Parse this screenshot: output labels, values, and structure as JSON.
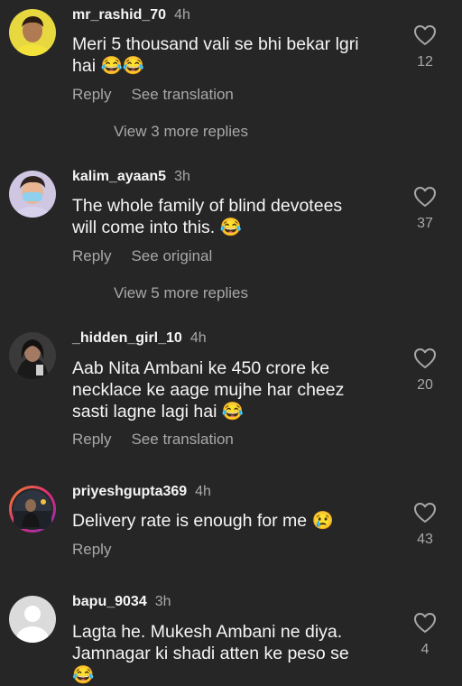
{
  "comments": [
    {
      "username": "mr_rashid_70",
      "time": "4h",
      "text": "Meri 5 thousand vali se bhi bekar lgri hai 😂😂",
      "likes": "12",
      "reply_label": "Reply",
      "second_action": "See translation",
      "view_more": "View 3 more replies"
    },
    {
      "username": "kalim_ayaan5",
      "time": "3h",
      "text": "The whole family of blind devotees will come into this. 😂",
      "likes": "37",
      "reply_label": "Reply",
      "second_action": "See original",
      "view_more": "View 5 more replies"
    },
    {
      "username": "_hidden_girl_10",
      "time": "4h",
      "text": "Aab Nita Ambani ke 450 crore ke necklace ke aage mujhe har cheez sasti lagne lagi hai 😂",
      "likes": "20",
      "reply_label": "Reply",
      "second_action": "See translation"
    },
    {
      "username": "priyeshgupta369",
      "time": "4h",
      "text": "Delivery rate is enough for me 😢",
      "likes": "43",
      "reply_label": "Reply"
    },
    {
      "username": "bapu_9034",
      "time": "3h",
      "text": "Lagta he.  Mukesh Ambani ne diya. Jamnagar ki shadi atten ke peso se 😂",
      "likes": "4"
    }
  ],
  "icons": {
    "like": "heart-outline-icon"
  },
  "colors": {
    "background": "#262626",
    "primary_text": "#f5f5f5",
    "secondary_text": "#a8a8a8",
    "story_ring": "#c13584"
  }
}
